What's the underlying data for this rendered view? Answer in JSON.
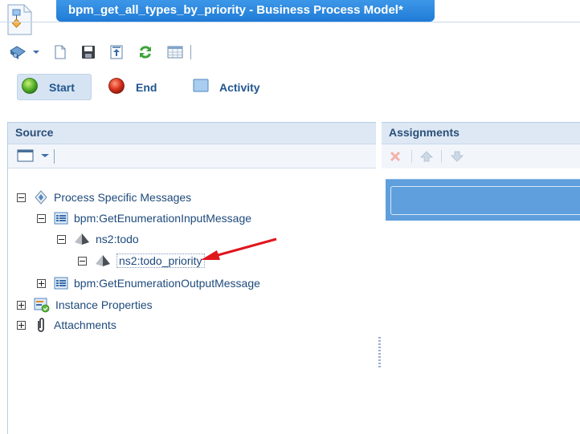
{
  "window": {
    "title": "bpm_get_all_types_by_priority - Business Process Model*"
  },
  "toolbar": {
    "buttons": [
      {
        "name": "process-menu",
        "icon": "process-icon"
      },
      {
        "name": "new",
        "icon": "new-document-icon"
      },
      {
        "name": "save",
        "icon": "save-icon"
      },
      {
        "name": "export",
        "icon": "export-icon"
      },
      {
        "name": "refresh",
        "icon": "refresh-icon"
      },
      {
        "name": "layout",
        "icon": "grid-table-icon"
      }
    ]
  },
  "palette": {
    "start_label": "Start",
    "end_label": "End",
    "activity_label": "Activity"
  },
  "source": {
    "title": "Source",
    "tree": {
      "process_specific_messages": "Process Specific Messages",
      "input_message": "bpm:GetEnumerationInputMessage",
      "todo": "ns2:todo",
      "todo_priority": "ns2:todo_priority",
      "output_message": "bpm:GetEnumerationOutputMessage",
      "instance_properties": "Instance Properties",
      "attachments": "Attachments"
    }
  },
  "assignments": {
    "title": "Assignments"
  },
  "colors": {
    "title_tab": "#2a88e0",
    "panel_header": "#dde8f4",
    "assign_box": "#5f9fdd",
    "annotation_arrow": "#e0161d"
  }
}
